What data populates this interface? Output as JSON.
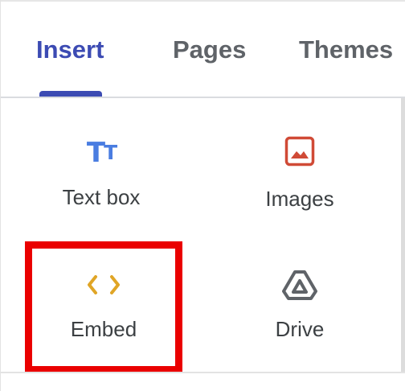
{
  "tabs": [
    {
      "label": "Insert",
      "active": true
    },
    {
      "label": "Pages",
      "active": false
    },
    {
      "label": "Themes",
      "active": false
    }
  ],
  "items": [
    {
      "label": "Text box",
      "icon": "text-box-icon",
      "icon_glyph": "T",
      "icon_glyph_small": "T",
      "color": "#4a7de1"
    },
    {
      "label": "Images",
      "icon": "image-icon",
      "color": "#d04a36"
    },
    {
      "label": "Embed",
      "icon": "embed-code-icon",
      "icon_glyph": "‹ ›",
      "color": "#e0a526"
    },
    {
      "label": "Drive",
      "icon": "drive-icon",
      "color": "#5f6368"
    }
  ],
  "highlight": {
    "target": "Embed",
    "color": "#ea0000"
  },
  "colors": {
    "accent": "#3c4bb3",
    "tab_inactive": "#5f6368",
    "label_text": "#3c4043"
  }
}
